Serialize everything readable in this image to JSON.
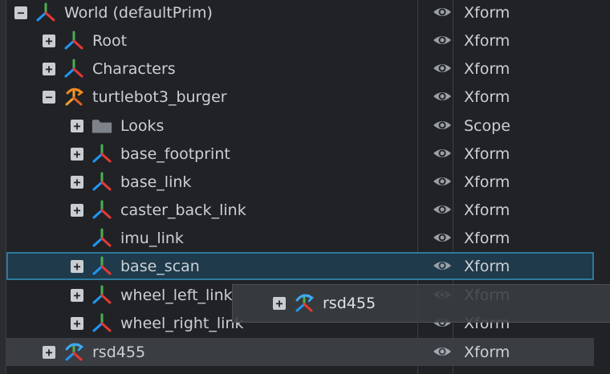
{
  "tree": {
    "rows": [
      {
        "name": "World (defaultPrim)",
        "type": "Xform",
        "expander": "−",
        "icon": "xform-icon"
      },
      {
        "name": "Root",
        "type": "Xform",
        "expander": "+",
        "icon": "xform-icon"
      },
      {
        "name": "Characters",
        "type": "Xform",
        "expander": "+",
        "icon": "xform-icon"
      },
      {
        "name": "turtlebot3_burger",
        "type": "Xform",
        "expander": "−",
        "icon": "robot-icon"
      },
      {
        "name": "Looks",
        "type": "Scope",
        "expander": "+",
        "icon": "folder-icon"
      },
      {
        "name": "base_footprint",
        "type": "Xform",
        "expander": "+",
        "icon": "xform-icon"
      },
      {
        "name": "base_link",
        "type": "Xform",
        "expander": "+",
        "icon": "xform-icon"
      },
      {
        "name": "caster_back_link",
        "type": "Xform",
        "expander": "+",
        "icon": "xform-icon"
      },
      {
        "name": "imu_link",
        "type": "Xform",
        "expander": "",
        "icon": "xform-icon"
      },
      {
        "name": "base_scan",
        "type": "Xform",
        "expander": "+",
        "icon": "xform-icon"
      },
      {
        "name": "wheel_left_link",
        "type": "Xform",
        "expander": "+",
        "icon": "xform-icon"
      },
      {
        "name": "wheel_right_link",
        "type": "Xform",
        "expander": "+",
        "icon": "xform-icon"
      },
      {
        "name": "rsd455",
        "type": "Xform",
        "expander": "+",
        "icon": "camera-asset-icon"
      }
    ],
    "drag_ghost": {
      "name": "rsd455",
      "expander": "+",
      "icon": "camera-asset-icon"
    }
  },
  "colors": {
    "background": "#202226",
    "selection_fill": "#1f3a4b",
    "selection_border": "#2a7a9c",
    "text": "#cbd0d5"
  }
}
